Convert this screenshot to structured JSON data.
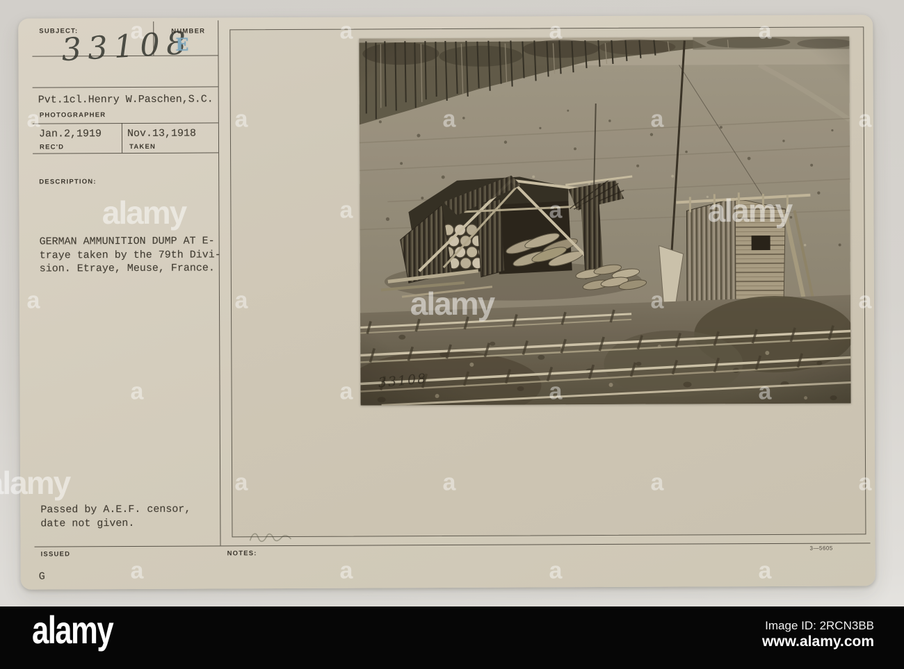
{
  "watermark": {
    "brand": "alamy",
    "letter": "a"
  },
  "card": {
    "subject_label": "SUBJECT:",
    "subject_number": "33108",
    "number_label": "NUMBER",
    "number_stamp": "E",
    "photographer_name": "Pvt.1cl.Henry W.Paschen,S.C.",
    "photographer_label": "PHOTOGRAPHER",
    "received_date": "Jan.2,1919",
    "received_label": "REC'D",
    "taken_date": "Nov.13,1918",
    "taken_label": "TAKEN",
    "description_label": "DESCRIPTION:",
    "description_lines": [
      "GERMAN AMMUNITION DUMP AT E-",
      "traye taken by the 79th Divi-",
      "sion. Etraye, Meuse, France."
    ],
    "censor_lines": [
      "Passed by A.E.F. censor,",
      "date not given."
    ],
    "issued_label": "ISSUED",
    "issued_value": "G",
    "notes_label": "NOTES:",
    "print_code": "3—5605",
    "photo_etched_number": "33108"
  },
  "footer": {
    "logo": "alamy",
    "image_id": "Image ID: 2RCN3BB",
    "url": "www.alamy.com"
  },
  "colors": {
    "page_bg": "#d6d3ce",
    "card_bg": "#d4cdbd",
    "footer_bar": "#060606",
    "stamp_blue": "#7fa8bd",
    "line": "#3c372e",
    "watermark": "#ffffff"
  }
}
